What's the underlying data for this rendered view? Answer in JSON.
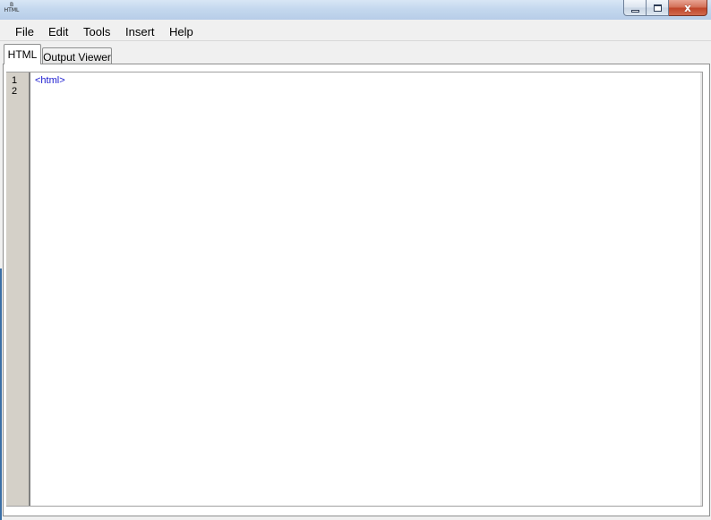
{
  "window": {
    "icon_text_top": "B",
    "icon_text_bottom": "HTML",
    "controls": {
      "minimize": "minimize",
      "maximize": "maximize",
      "close": "x"
    }
  },
  "menu": [
    "File",
    "Edit",
    "Tools",
    "Insert",
    "Help"
  ],
  "tabs": [
    {
      "label": "HTML",
      "active": true
    },
    {
      "label": "Output Viewer",
      "active": false
    }
  ],
  "editor": {
    "line_numbers": [
      "1",
      "2"
    ],
    "lines": [
      "<html>",
      ""
    ]
  },
  "colors": {
    "code_tag": "#1a1ad0",
    "gutter": "#d4d0c8",
    "title_bar": "#c4d8ee",
    "close_button": "#c0452a"
  }
}
